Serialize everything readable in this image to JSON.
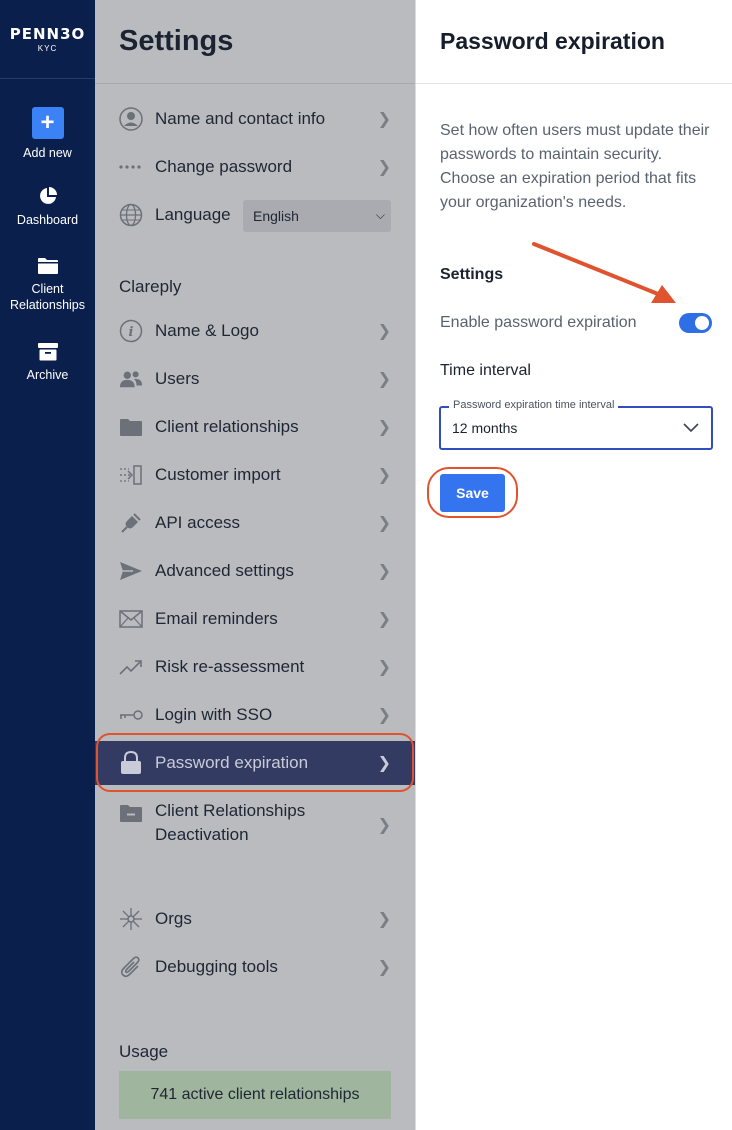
{
  "app": {
    "brand": "PENN3O",
    "sub": "KYC"
  },
  "leftnav": {
    "items": [
      {
        "label": "Add new",
        "icon": "plus-icon"
      },
      {
        "label": "Dashboard",
        "icon": "pie-chart-icon"
      },
      {
        "label": "Client Relationships",
        "icon": "folder-icon"
      },
      {
        "label": "Archive",
        "icon": "archive-icon"
      }
    ]
  },
  "settings": {
    "title": "Settings",
    "top_items": [
      {
        "label": "Name and contact info",
        "icon": "user-circle-icon"
      },
      {
        "label": "Change password",
        "icon": "dots-icon"
      },
      {
        "label": "Language",
        "icon": "globe-icon"
      }
    ],
    "language_value": "English",
    "section_title": "Clareply",
    "items": [
      {
        "label": "Name & Logo",
        "icon": "info-icon"
      },
      {
        "label": "Users",
        "icon": "users-icon"
      },
      {
        "label": "Client relationships",
        "icon": "folder-icon"
      },
      {
        "label": "Customer import",
        "icon": "import-icon"
      },
      {
        "label": "API access",
        "icon": "plug-icon"
      },
      {
        "label": "Advanced settings",
        "icon": "send-icon"
      },
      {
        "label": "Email reminders",
        "icon": "mail-icon"
      },
      {
        "label": "Risk re-assessment",
        "icon": "trend-icon"
      },
      {
        "label": "Login with SSO",
        "icon": "key-icon"
      },
      {
        "label": "Password expiration",
        "icon": "lock-icon"
      },
      {
        "label": "Client Relationships Deactivation",
        "label_line1": "Client Relationships",
        "label_line2": "Deactivation",
        "icon": "folder-minus-icon"
      }
    ],
    "extra_items": [
      {
        "label": "Orgs",
        "icon": "network-icon"
      },
      {
        "label": "Debugging tools",
        "icon": "paperclip-icon"
      }
    ],
    "usage_title": "Usage",
    "usage_text": "741 active client relationships"
  },
  "panel": {
    "title": "Password expiration",
    "description": "Set how often users must update their passwords to maintain security. Choose an expiration period that fits your organization's needs.",
    "settings_label": "Settings",
    "toggle_label": "Enable password expiration",
    "toggle_on": true,
    "interval_label": "Time interval",
    "field_label": "Password expiration time interval",
    "field_value": "12 months",
    "save_label": "Save"
  },
  "colors": {
    "nav_bg": "#0b1f4d",
    "accent": "#3574ef",
    "annotation": "#e0532f",
    "active_row": "#343b62"
  }
}
